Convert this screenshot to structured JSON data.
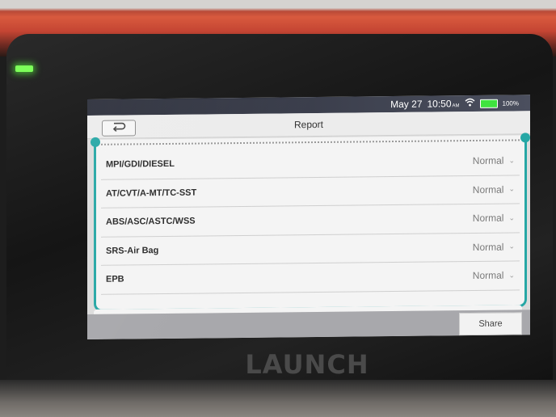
{
  "device": {
    "brand": "LAUNCH",
    "led_color": "#7dff5a"
  },
  "statusbar": {
    "date": "May 27",
    "time": "10:50",
    "ampm": "AM",
    "wifi_icon": "wifi-icon",
    "battery_icon": "battery-icon",
    "battery_pct": "100%"
  },
  "titlebar": {
    "back_icon": "back-arrow-icon",
    "title": "Report"
  },
  "report": {
    "items": [
      {
        "label": "MPI/GDI/DIESEL",
        "status": "Normal"
      },
      {
        "label": "AT/CVT/A-MT/TC-SST",
        "status": "Normal"
      },
      {
        "label": "ABS/ASC/ASTC/WSS",
        "status": "Normal"
      },
      {
        "label": "SRS-Air Bag",
        "status": "Normal"
      },
      {
        "label": "EPB",
        "status": "Normal"
      }
    ]
  },
  "footer": {
    "share_label": "Share"
  },
  "colors": {
    "accent": "#26a7a5",
    "battery": "#3fe33f"
  }
}
